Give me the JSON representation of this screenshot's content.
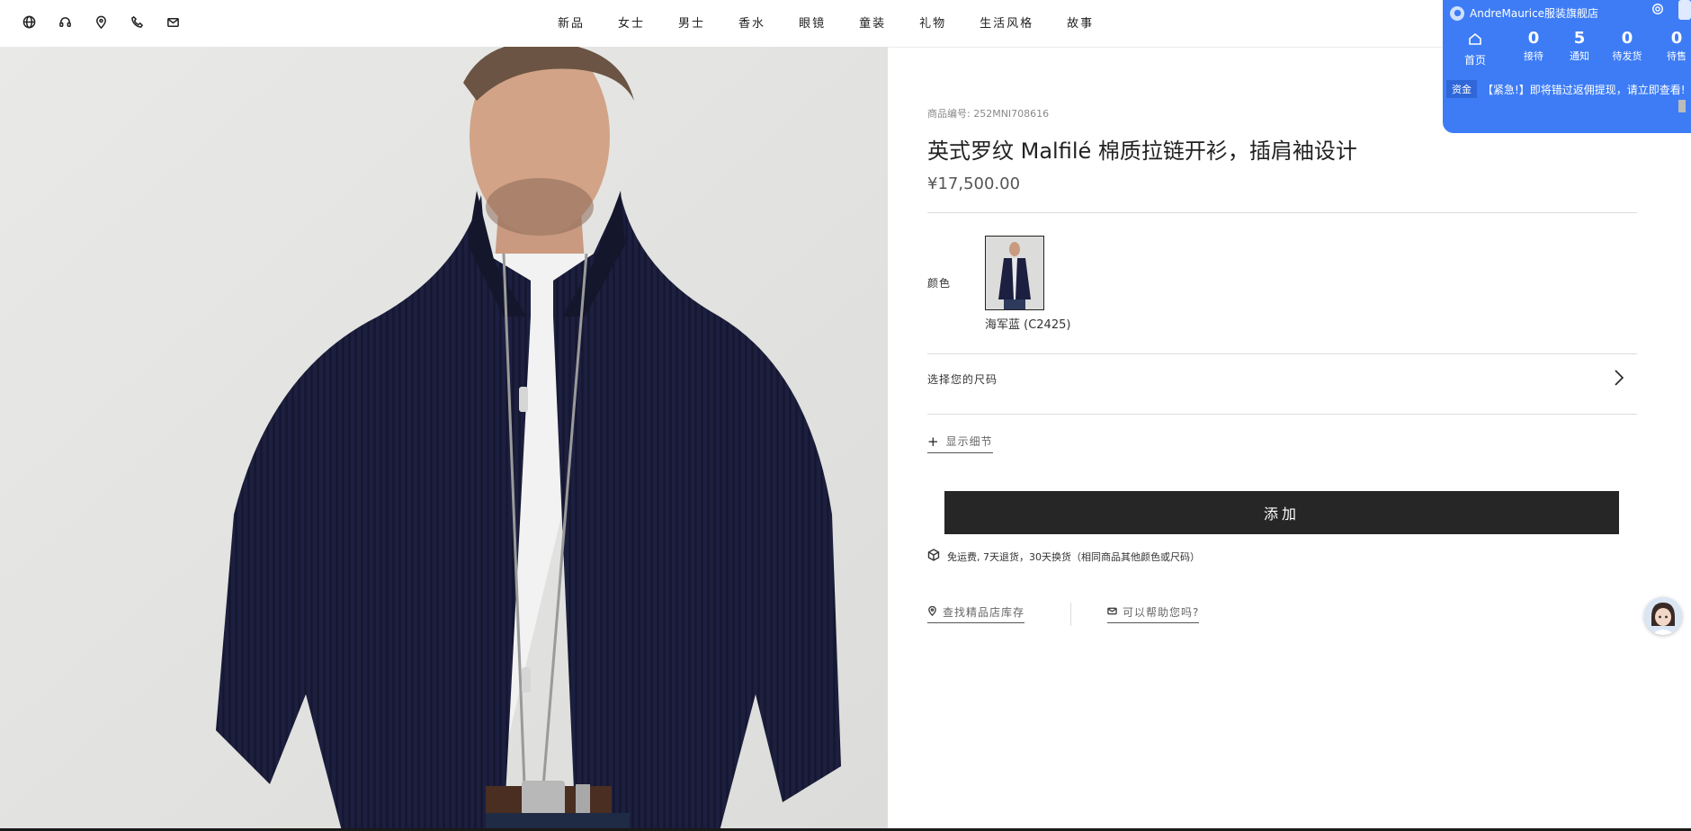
{
  "top_icons": [
    "globe-icon",
    "headset-icon",
    "location-pin-icon",
    "phone-icon",
    "mail-icon"
  ],
  "nav": [
    "新品",
    "女士",
    "男士",
    "香水",
    "眼镜",
    "童装",
    "礼物",
    "生活风格",
    "故事"
  ],
  "product": {
    "sku_label": "商品编号: 252MNI708616",
    "title": "英式罗纹 Malfilé 棉质拉链开衫，插肩袖设计",
    "price": "¥17,500.00",
    "color_label": "颜色",
    "color_name": "海军蓝 (C2425)",
    "size_label": "选择您的尺码",
    "details_label": "显示细节",
    "add_button": "添加",
    "shipping_text": "免运费, 7天退货，30天换货（相同商品其他颜色或尺码）",
    "store_link": "查找精品店库存",
    "help_link": "可以帮助您吗?"
  },
  "widget": {
    "shop_name": "AndreMaurice服装旗舰店",
    "home_label": "首页",
    "stats": [
      {
        "value": "0",
        "label": "接待"
      },
      {
        "value": "5",
        "label": "通知"
      },
      {
        "value": "0",
        "label": "待发货"
      },
      {
        "value": "0",
        "label": "待售"
      }
    ],
    "notice_tag": "资金",
    "notice_text": "【紧急!】即将错过返佣提现，请立即查看!",
    "color": "#3d7cf5"
  },
  "colors": {
    "sweater": "#1c1f3f",
    "button": "#262626",
    "background": "#e7e7e5"
  }
}
